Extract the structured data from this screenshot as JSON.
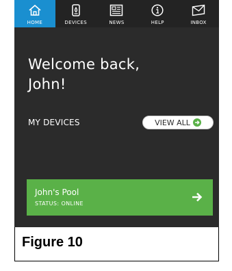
{
  "nav": {
    "items": [
      {
        "label": "HOME",
        "icon": "home-icon",
        "active": true
      },
      {
        "label": "DEVICES",
        "icon": "device-icon",
        "active": false
      },
      {
        "label": "NEWS",
        "icon": "news-icon",
        "active": false
      },
      {
        "label": "HELP",
        "icon": "info-icon",
        "active": false
      },
      {
        "label": "INBOX",
        "icon": "envelope-icon",
        "active": false
      }
    ],
    "active_color": "#1a8fd0"
  },
  "welcome": {
    "line1": "Welcome back,",
    "line2": "John!"
  },
  "devices_section": {
    "title": "MY DEVICES",
    "view_all_label": "VIEW ALL",
    "view_all_icon": "arrow-circle-icon"
  },
  "device_card": {
    "name": "John's Pool",
    "status": "STATUS: ONLINE",
    "icon": "arrow-right-icon",
    "color": "#5ab148"
  },
  "caption": {
    "text": "Figure 10"
  }
}
